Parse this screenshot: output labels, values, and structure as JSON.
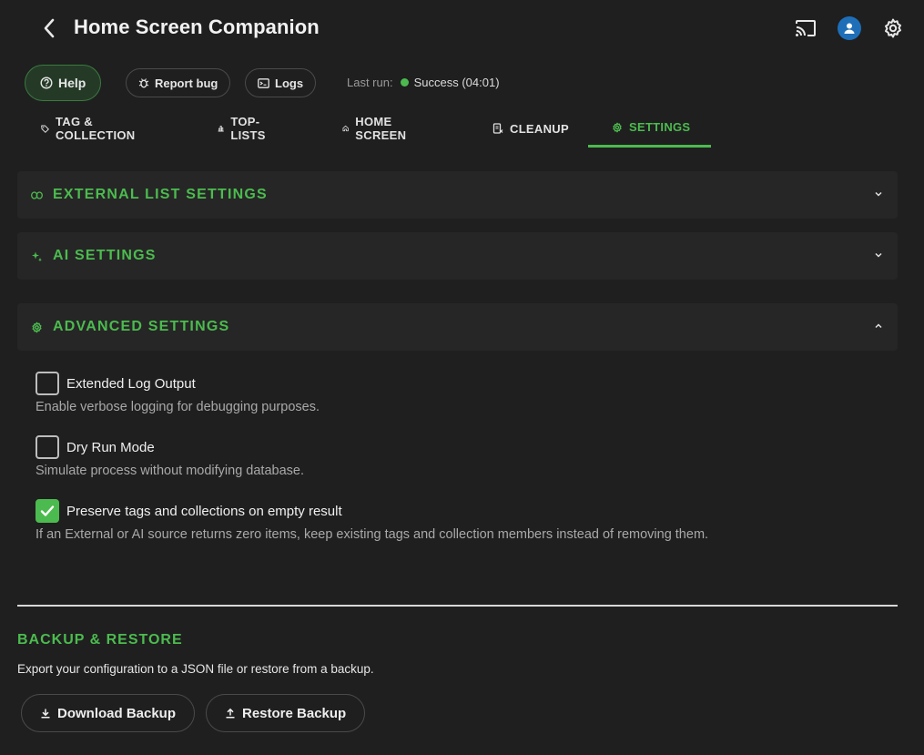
{
  "header": {
    "title": "Home Screen Companion",
    "icons": [
      "back-icon",
      "cast-icon",
      "user-icon",
      "gear-icon"
    ]
  },
  "actions": {
    "help_label": "Help",
    "report_bug_label": "Report bug",
    "logs_label": "Logs",
    "last_run_label": "Last run:",
    "last_run_status": "Success (04:01)",
    "status_color": "#4cbb4f"
  },
  "tabs": [
    {
      "label": "TAG & COLLECTION",
      "icon": "tag-icon"
    },
    {
      "label": "TOP-LISTS",
      "icon": "bar-chart-icon"
    },
    {
      "label": "HOME SCREEN",
      "icon": "home-icon"
    },
    {
      "label": "CLEANUP",
      "icon": "cleanup-icon"
    },
    {
      "label": "SETTINGS",
      "icon": "gear-icon",
      "active": true
    }
  ],
  "sections": {
    "external": {
      "title": "EXTERNAL LIST SETTINGS",
      "icon": "link-icon",
      "expanded": false
    },
    "ai": {
      "title": "AI SETTINGS",
      "icon": "sparkle-icon",
      "expanded": false
    },
    "advanced": {
      "title": "ADVANCED SETTINGS",
      "icon": "gear-icon",
      "expanded": true
    }
  },
  "advanced_options": [
    {
      "label": "Extended Log Output",
      "description": "Enable verbose logging for debugging purposes.",
      "checked": false
    },
    {
      "label": "Dry Run Mode",
      "description": "Simulate process without modifying database.",
      "checked": false
    },
    {
      "label": "Preserve tags and collections on empty result",
      "description": "If an External or AI source returns zero items, keep existing tags and collection members instead of removing them.",
      "checked": true
    }
  ],
  "backup": {
    "title": "BACKUP & RESTORE",
    "description": "Export your configuration to a JSON file or restore from a backup.",
    "download_label": "Download Backup",
    "restore_label": "Restore Backup"
  },
  "colors": {
    "accent": "#4cbb4f",
    "background": "#1f1f1f",
    "panel": "#262626"
  }
}
